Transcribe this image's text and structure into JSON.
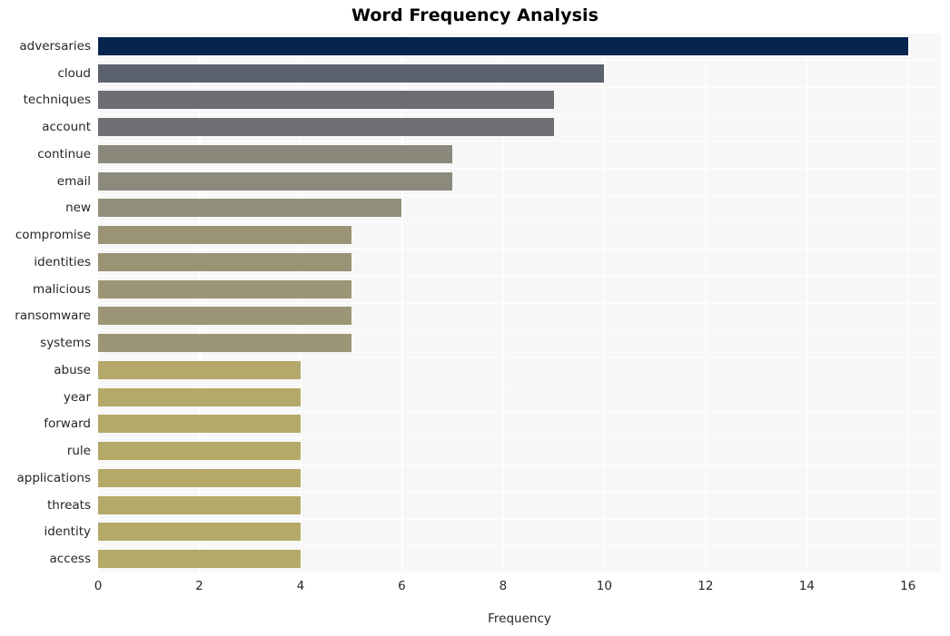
{
  "chart_data": {
    "type": "bar",
    "orientation": "horizontal",
    "title": "Word Frequency Analysis",
    "xlabel": "Frequency",
    "ylabel": "",
    "categories": [
      "adversaries",
      "cloud",
      "techniques",
      "account",
      "continue",
      "email",
      "new",
      "compromise",
      "identities",
      "malicious",
      "ransomware",
      "systems",
      "abuse",
      "year",
      "forward",
      "rule",
      "applications",
      "threats",
      "identity",
      "access"
    ],
    "values": [
      16,
      10,
      9,
      9,
      7,
      7,
      6,
      5,
      5,
      5,
      5,
      5,
      4,
      4,
      4,
      4,
      4,
      4,
      4,
      4
    ],
    "bar_colors": [
      "#06254e",
      "#5d6270",
      "#6b6d73",
      "#6e7076",
      "#8b897c",
      "#8c8a7d",
      "#928f7b",
      "#9a9375",
      "#9a9375",
      "#9c9576",
      "#9c9576",
      "#9c9576",
      "#b4a86a",
      "#b5a969",
      "#b5a969",
      "#b5a969",
      "#b5a969",
      "#b5a969",
      "#b5a969",
      "#b5a969"
    ],
    "xlim": [
      0,
      16.65
    ],
    "xticks": [
      0,
      2,
      4,
      6,
      8,
      10,
      12,
      14,
      16
    ],
    "xtick_labels": [
      "0",
      "2",
      "4",
      "6",
      "8",
      "10",
      "12",
      "14",
      "16"
    ],
    "grid": true,
    "grid_color": "#ffffff",
    "plot_background": "#f7f7f7",
    "figure_background": "#ffffff",
    "legend": null
  }
}
